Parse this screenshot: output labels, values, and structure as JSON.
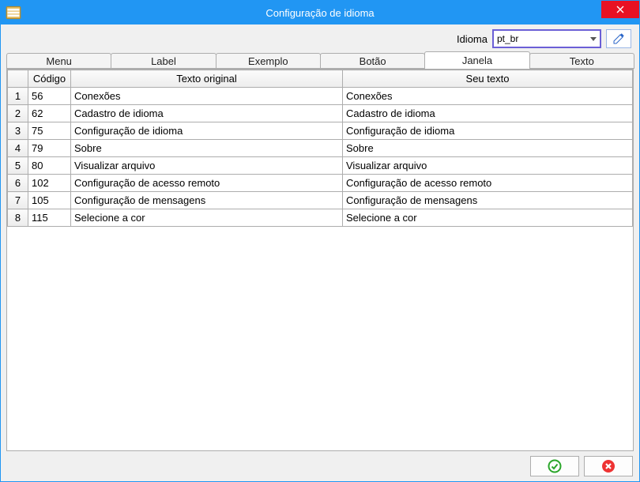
{
  "window": {
    "title": "Configuração de idioma"
  },
  "idioma": {
    "label": "Idioma",
    "value": "pt_br"
  },
  "tabs": {
    "items": [
      {
        "label": "Menu"
      },
      {
        "label": "Label"
      },
      {
        "label": "Exemplo"
      },
      {
        "label": "Botão"
      },
      {
        "label": "Janela"
      },
      {
        "label": "Texto"
      }
    ],
    "active_index": 4
  },
  "columns": {
    "codigo": "Código",
    "original": "Texto original",
    "seu": "Seu texto"
  },
  "rows": [
    {
      "n": "1",
      "codigo": "56",
      "orig": "Conexões",
      "seu": "Conexões"
    },
    {
      "n": "2",
      "codigo": "62",
      "orig": "Cadastro de idioma",
      "seu": "Cadastro de idioma"
    },
    {
      "n": "3",
      "codigo": "75",
      "orig": "Configuração de idioma",
      "seu": "Configuração de idioma"
    },
    {
      "n": "4",
      "codigo": "79",
      "orig": "Sobre",
      "seu": "Sobre"
    },
    {
      "n": "5",
      "codigo": "80",
      "orig": "Visualizar arquivo",
      "seu": "Visualizar arquivo"
    },
    {
      "n": "6",
      "codigo": "102",
      "orig": "Configuração de acesso remoto",
      "seu": "Configuração de acesso remoto"
    },
    {
      "n": "7",
      "codigo": "105",
      "orig": "Configuração de mensagens",
      "seu": "Configuração de mensagens"
    },
    {
      "n": "8",
      "codigo": "115",
      "orig": "Selecione a cor",
      "seu": "Selecione a cor"
    }
  ],
  "icons": {
    "app": "app-icon",
    "close": "close-icon",
    "edit": "pencil-icon",
    "ok": "ok-icon",
    "cancel": "cancel-icon"
  }
}
